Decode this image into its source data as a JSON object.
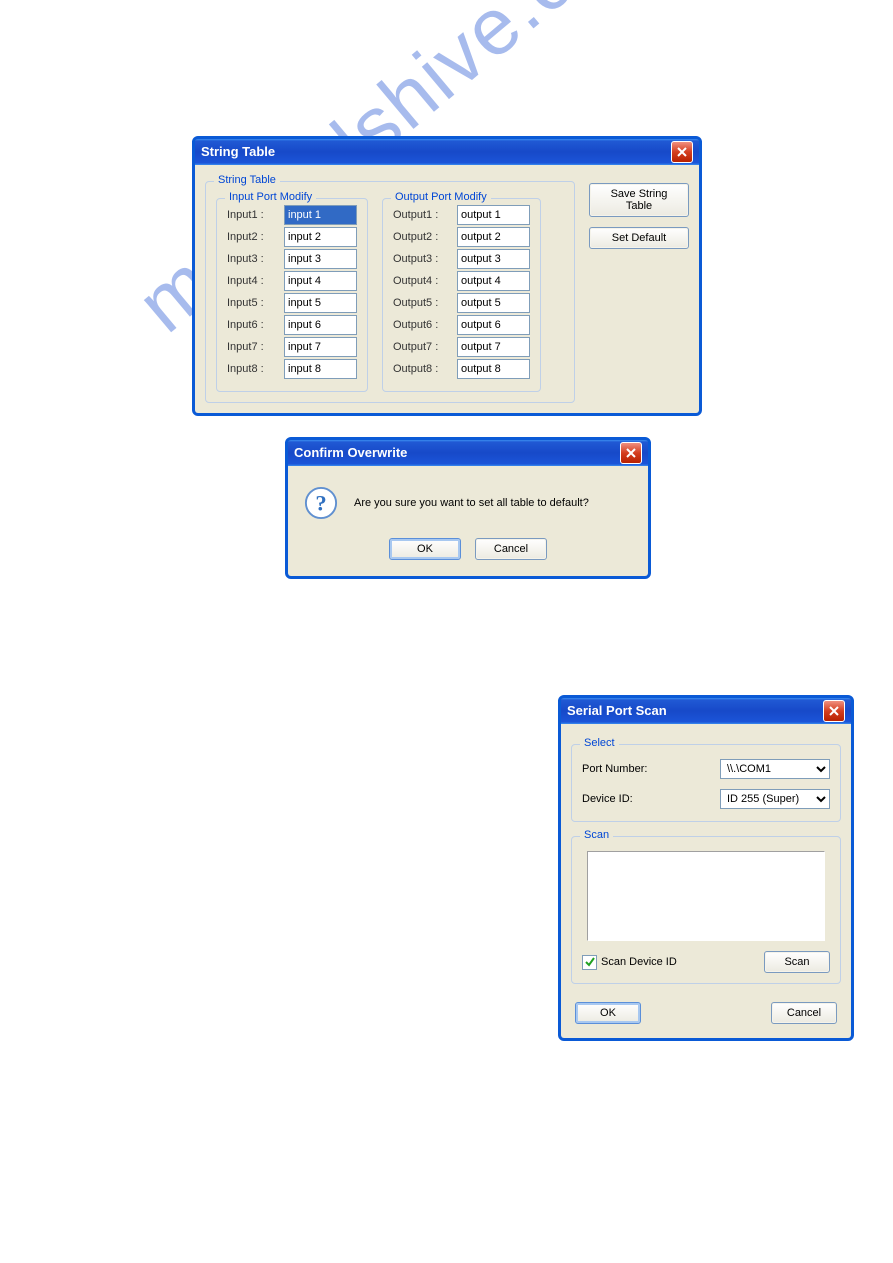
{
  "watermark": "manualshive.com",
  "string_table": {
    "title": "String Table",
    "group_label": "String Table",
    "input_group_label": "Input Port Modify",
    "output_group_label": "Output Port Modify",
    "inputs": [
      {
        "label": "Input1 :",
        "value": "input 1"
      },
      {
        "label": "Input2 :",
        "value": "input 2"
      },
      {
        "label": "Input3 :",
        "value": "input 3"
      },
      {
        "label": "Input4 :",
        "value": "input 4"
      },
      {
        "label": "Input5 :",
        "value": "input 5"
      },
      {
        "label": "Input6 :",
        "value": "input 6"
      },
      {
        "label": "Input7 :",
        "value": "input 7"
      },
      {
        "label": "Input8 :",
        "value": "input 8"
      }
    ],
    "outputs": [
      {
        "label": "Output1 :",
        "value": "output 1"
      },
      {
        "label": "Output2 :",
        "value": "output 2"
      },
      {
        "label": "Output3 :",
        "value": "output 3"
      },
      {
        "label": "Output4 :",
        "value": "output 4"
      },
      {
        "label": "Output5 :",
        "value": "output 5"
      },
      {
        "label": "Output6 :",
        "value": "output 6"
      },
      {
        "label": "Output7 :",
        "value": "output 7"
      },
      {
        "label": "Output8 :",
        "value": "output 8"
      }
    ],
    "save_button": "Save String Table",
    "default_button": "Set Default"
  },
  "confirm": {
    "title": "Confirm Overwrite",
    "message": "Are you sure you want to set all table to default?",
    "ok": "OK",
    "cancel": "Cancel"
  },
  "serial": {
    "title": "Serial Port Scan",
    "select_group": "Select",
    "port_label": "Port Number:",
    "port_value": "\\\\.\\COM1",
    "device_label": "Device ID:",
    "device_value": "ID 255 (Super)",
    "scan_group": "Scan",
    "scan_checkbox": "Scan Device ID",
    "scan_button": "Scan",
    "ok": "OK",
    "cancel": "Cancel"
  }
}
